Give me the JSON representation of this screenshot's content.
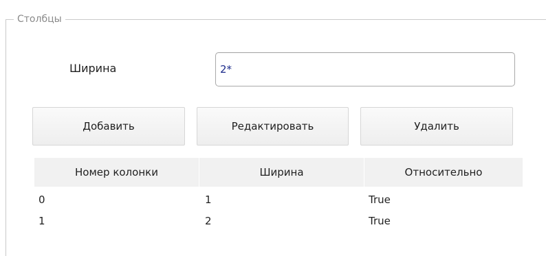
{
  "group": {
    "title": "Столбцы"
  },
  "width_field": {
    "label": "Ширина",
    "value": "2*"
  },
  "buttons": {
    "add": "Добавить",
    "edit": "Редактировать",
    "delete": "Удалить"
  },
  "table": {
    "headers": [
      "Номер колонки",
      "Ширина",
      "Относительно"
    ],
    "rows": [
      [
        "0",
        "1",
        "True"
      ],
      [
        "1",
        "2",
        "True"
      ]
    ]
  }
}
